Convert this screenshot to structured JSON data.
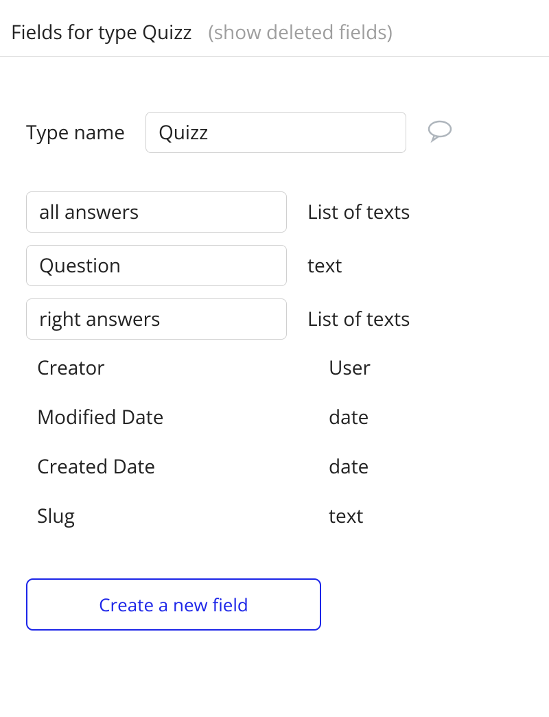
{
  "header": {
    "title": "Fields for type Quizz",
    "show_deleted_label": "(show deleted fields)"
  },
  "type_name": {
    "label": "Type name",
    "value": "Quizz"
  },
  "custom_fields": [
    {
      "name": "all answers",
      "type": "List of texts"
    },
    {
      "name": "Question",
      "type": "text"
    },
    {
      "name": "right answers",
      "type": "List of texts"
    }
  ],
  "builtin_fields": [
    {
      "name": "Creator",
      "type": "User"
    },
    {
      "name": "Modified Date",
      "type": "date"
    },
    {
      "name": "Created Date",
      "type": "date"
    },
    {
      "name": "Slug",
      "type": "text"
    }
  ],
  "create_button_label": "Create a new field"
}
